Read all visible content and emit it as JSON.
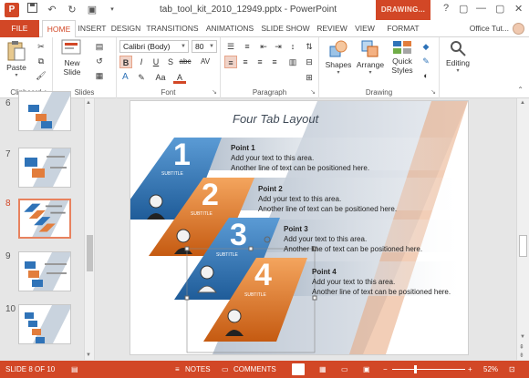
{
  "window": {
    "title": "tab_tool_kit_2010_12949.pptx - PowerPoint",
    "context_tab": "DRAWING...",
    "app_icon": "P",
    "controls": [
      "?",
      "▢",
      "—",
      "▢",
      "✕"
    ]
  },
  "tabs": [
    "FILE",
    "HOME",
    "INSERT",
    "DESIGN",
    "TRANSITIONS",
    "ANIMATIONS",
    "SLIDE SHOW",
    "REVIEW",
    "VIEW",
    "FORMAT"
  ],
  "user": {
    "name": "Office Tut..."
  },
  "ribbon": {
    "clipboard": {
      "label": "Clipboard",
      "paste": "Paste"
    },
    "slides": {
      "label": "Slides",
      "new_slide_line1": "New",
      "new_slide_line2": "Slide"
    },
    "font": {
      "label": "Font",
      "font_name": "Calibri (Body)",
      "font_size": "80",
      "bold": "B",
      "italic": "I",
      "underline": "U",
      "shadow": "S",
      "strike": "abc",
      "spacing": "AV",
      "case": "Aa",
      "color": "A"
    },
    "paragraph": {
      "label": "Paragraph"
    },
    "drawing": {
      "label": "Drawing",
      "shapes": "Shapes",
      "arrange": "Arrange",
      "quick_styles_line1": "Quick",
      "quick_styles_line2": "Styles"
    },
    "editing": {
      "label": "Editing"
    }
  },
  "thumbnails": [
    {
      "number": "6",
      "active": false
    },
    {
      "number": "7",
      "active": false
    },
    {
      "number": "8",
      "active": true
    },
    {
      "number": "9",
      "active": false
    },
    {
      "number": "10",
      "active": false
    }
  ],
  "slide": {
    "title": "Four Tab Layout",
    "tabs": [
      {
        "number": "1",
        "subtitle": "SUBTITLE",
        "heading": "Point 1",
        "line1": "Add your text to this area.",
        "line2": "Another line of text can be positioned here."
      },
      {
        "number": "2",
        "subtitle": "SUBTITLE",
        "heading": "Point 2",
        "line1": "Add your text to this area.",
        "line2": "Another line of text can be positioned here."
      },
      {
        "number": "3",
        "subtitle": "SUBTITLE",
        "heading": "Point 3",
        "line1": "Add your text to this area.",
        "line2": "Another line of text can be positioned here."
      },
      {
        "number": "4",
        "subtitle": "SUBTITLE",
        "heading": "Point 4",
        "line1": "Add your text to this area.",
        "line2": "Another line of text can be positioned here."
      }
    ]
  },
  "status": {
    "slide_indicator": "SLIDE 8 OF 10",
    "notes": "NOTES",
    "comments": "COMMENTS",
    "zoom": "52%"
  },
  "colors": {
    "accent": "#d24726",
    "blue_tab": "#2f73b8",
    "orange_tab": "#e27d3c",
    "slide_band": "#a9b8c9"
  }
}
